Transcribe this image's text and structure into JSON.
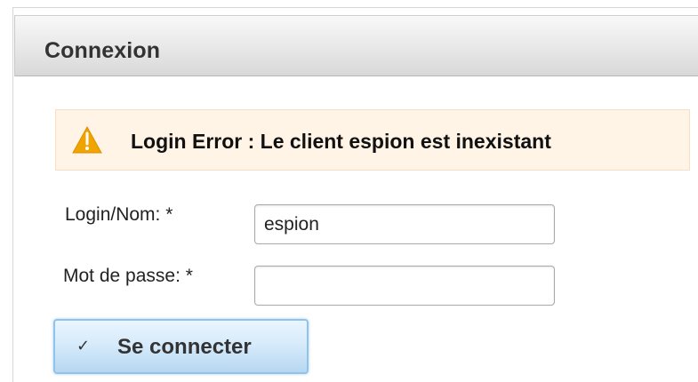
{
  "panel": {
    "title": "Connexion"
  },
  "alert": {
    "icon": "warning-icon",
    "message": "Login Error : Le client espion est inexistant",
    "background_color": "#fff4e6",
    "icon_color": "#f0a400"
  },
  "form": {
    "login": {
      "label": "Login/Nom: *",
      "value": "espion",
      "placeholder": ""
    },
    "password": {
      "label": "Mot de passe: *",
      "value": "",
      "placeholder": ""
    },
    "submit": {
      "label": "Se connecter",
      "icon": "check-icon",
      "color": "#d7ebfb"
    }
  }
}
